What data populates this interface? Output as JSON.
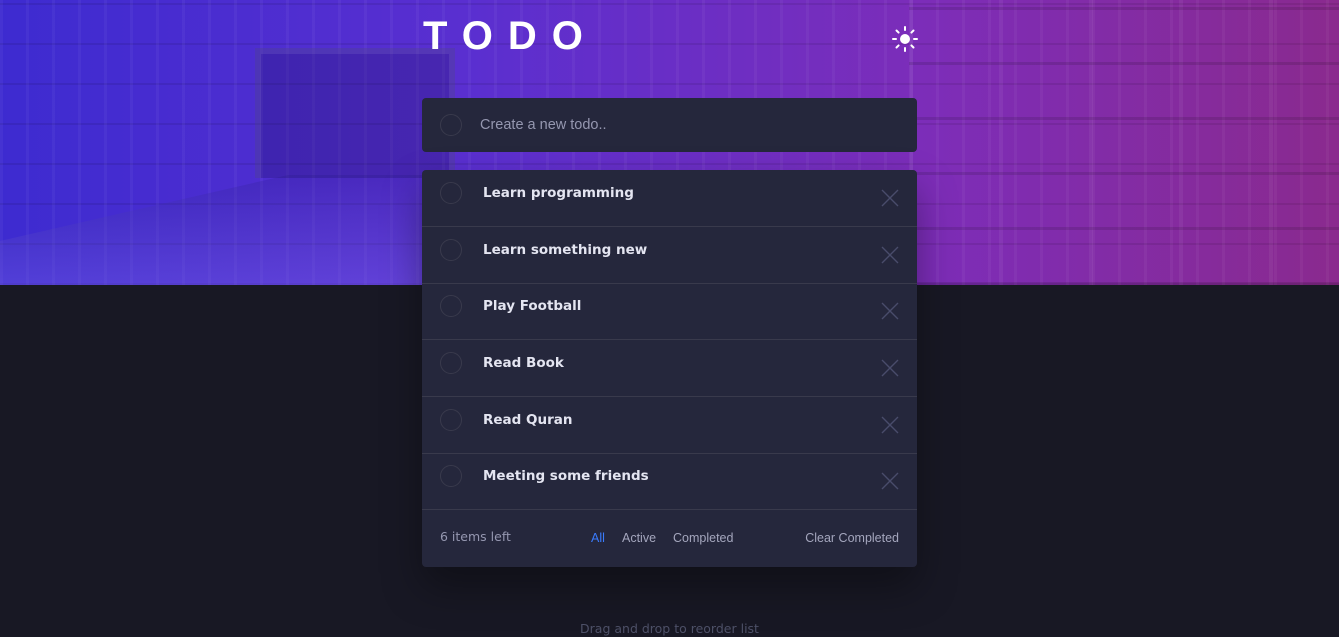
{
  "app": {
    "title": "TODO",
    "theme_icon": "sun-icon"
  },
  "new_todo": {
    "placeholder": "Create a new todo.."
  },
  "todos": [
    {
      "label": "Learn programming"
    },
    {
      "label": "Learn something new"
    },
    {
      "label": "Play Football"
    },
    {
      "label": "Read Book"
    },
    {
      "label": "Read Quran"
    },
    {
      "label": "Meeting some friends"
    }
  ],
  "footer": {
    "items_left": "6 items left",
    "filters": [
      "All",
      "Active",
      "Completed"
    ],
    "active_filter": "All",
    "clear_label": "Clear Completed"
  },
  "hint": "Drag and drop to reorder list",
  "colors": {
    "accent": "#3a7bfd",
    "card": "#25273c",
    "background": "#181824"
  }
}
